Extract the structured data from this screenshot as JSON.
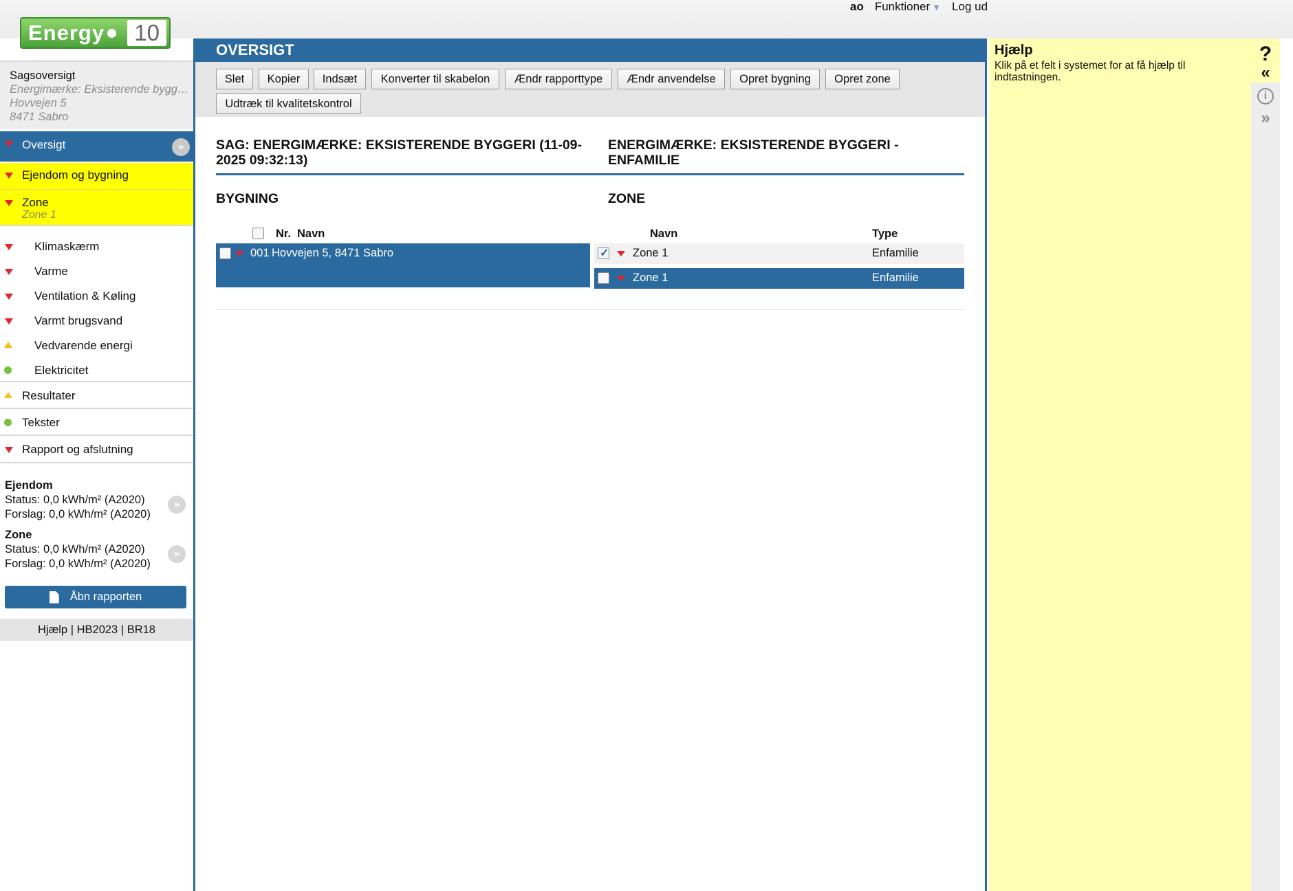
{
  "top": {
    "user": "ao",
    "functions": "Funktioner",
    "logout": "Log ud"
  },
  "logo": {
    "word": "Energy",
    "num": "10"
  },
  "case": {
    "title": "Sagsoversigt",
    "type": "Energimærke: Eksisterende byggeri",
    "street": "Hovvejen 5",
    "city": "8471 Sabro"
  },
  "nav": {
    "overview": "Oversigt",
    "property": "Ejendom og bygning",
    "zone": "Zone",
    "zone_sub": "Zone 1",
    "climate": "Klimaskærm",
    "heat": "Varme",
    "vent": "Ventilation & Køling",
    "hotwater": "Varmt brugsvand",
    "renew": "Vedvarende energi",
    "elec": "Elektricitet",
    "results": "Resultater",
    "texts": "Tekster",
    "report": "Rapport og afslutning"
  },
  "status": {
    "prop_title": "Ejendom",
    "prop_status": "Status: 0,0 kWh/m² (A2020)",
    "prop_proposal": "Forslag: 0,0 kWh/m² (A2020)",
    "zone_title": "Zone",
    "zone_status": "Status: 0,0 kWh/m² (A2020)",
    "zone_proposal": "Forslag: 0,0 kWh/m² (A2020)"
  },
  "open_report": "Åbn rapporten",
  "footer": {
    "help": "Hjælp",
    "sep": " | ",
    "hb": "HB2023",
    "br": "BR18"
  },
  "main": {
    "title": "OVERSIGT",
    "buttons": {
      "delete": "Slet",
      "copy": "Kopier",
      "insert": "Indsæt",
      "convert": "Konverter til skabelon",
      "report_type": "Ændr rapporttype",
      "usage": "Ændr anvendelse",
      "new_building": "Opret bygning",
      "new_zone": "Opret zone",
      "extract": "Udtræk til kvalitetskontrol"
    },
    "case_heading": "SAG: ENERGIMÆRKE: EKSISTERENDE BYGGERI (11-09-2025 09:32:13)",
    "type_heading": "ENERGIMÆRKE: EKSISTERENDE BYGGERI - ENFAMILIE",
    "building_title": "BYGNING",
    "zone_title": "ZONE",
    "building_cols": {
      "nr": "Nr.",
      "name": "Navn"
    },
    "zone_cols": {
      "name": "Navn",
      "type": "Type"
    },
    "building_row": {
      "nr": "001",
      "name": "Hovvejen 5, 8471 Sabro"
    },
    "zone_rows": [
      {
        "name": "Zone 1",
        "type": "Enfamilie",
        "checked": true
      },
      {
        "name": "Zone 1",
        "type": "Enfamilie",
        "checked": false
      }
    ]
  },
  "help": {
    "title": "Hjælp",
    "text": "Klik på et felt i systemet for at få hjælp til indtastningen."
  },
  "icons": {
    "question": "question-icon",
    "collapse": "double-chevron-left-icon",
    "info": "info-icon",
    "expand": "double-chevron-right-icon"
  },
  "colors": {
    "accent": "#2a6a9e",
    "highlight": "#ffff00",
    "help_bg": "#ffffb3",
    "error": "#e0262e",
    "warn": "#f2c11c",
    "ok": "#7ac142"
  }
}
